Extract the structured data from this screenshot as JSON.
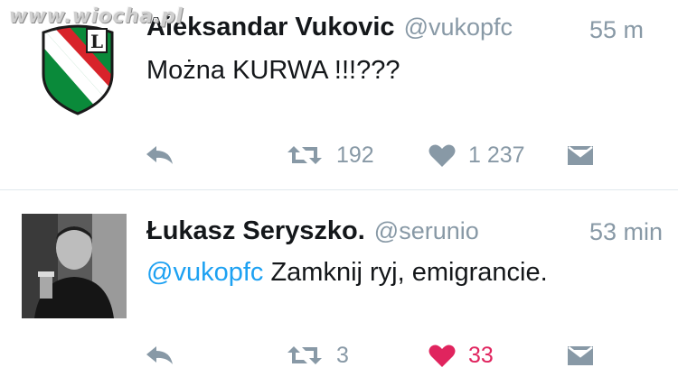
{
  "watermark": "www.wiocha.pl",
  "colors": {
    "text": "#14171a",
    "secondary": "#8899a6",
    "link": "#1da1f2",
    "liked": "#e0245e",
    "divider": "#e1e8ed"
  },
  "tweets": [
    {
      "name": "Aleksandar Vukovic",
      "handle": "@vukopfc",
      "time": "55 m",
      "avatar": "legia-crest",
      "text": "Można KURWA !!!???",
      "mention": "",
      "retweets": "192",
      "likes": "1 237",
      "liked": false
    },
    {
      "name": "Łukasz Seryszko.",
      "handle": "@serunio",
      "time": "53 min",
      "avatar": "profile-photo",
      "text": " Zamknij ryj, emigrancie.",
      "mention": "@vukopfc",
      "retweets": "3",
      "likes": "33",
      "liked": true
    }
  ],
  "icons": [
    "reply-icon",
    "retweet-icon",
    "heart-icon",
    "direct-message-icon"
  ]
}
